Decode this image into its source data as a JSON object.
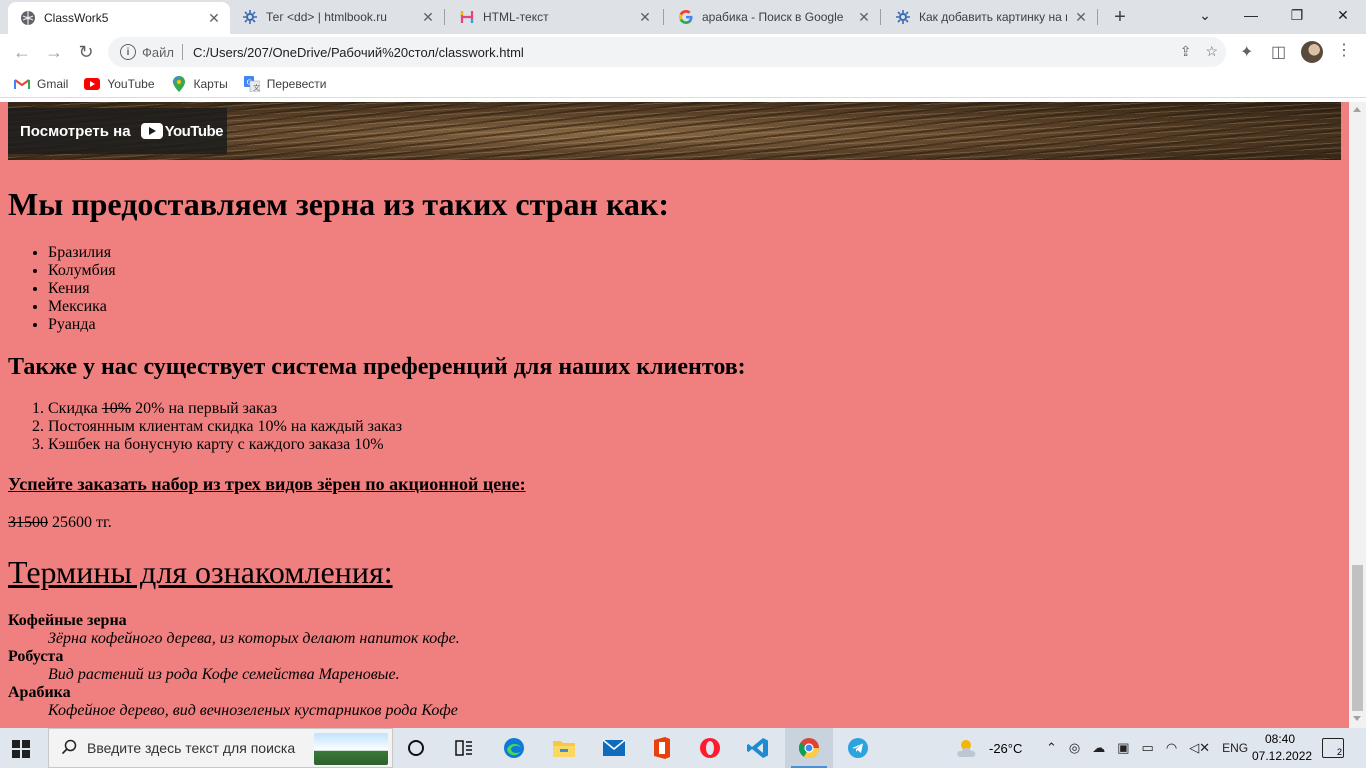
{
  "browser": {
    "tabs": [
      {
        "title": "ClassWork5",
        "icon": "globe-icon",
        "active": true
      },
      {
        "title": "Тег <dd> | htmlbook.ru",
        "icon": "htmlbook-icon",
        "active": false
      },
      {
        "title": "HTML-текст",
        "icon": "html-text-icon",
        "active": false
      },
      {
        "title": "арабика - Поиск в Google",
        "icon": "google-icon",
        "active": false
      },
      {
        "title": "Как добавить картинку на в",
        "icon": "htmlbook-icon",
        "active": false
      }
    ],
    "new_tab_label": "+",
    "address": {
      "scheme_label": "Файл",
      "url": "C:/Users/207/OneDrive/Рабочий%20стол/classwork.html"
    },
    "bookmarks": [
      {
        "label": "Gmail",
        "icon": "gmail-icon"
      },
      {
        "label": "YouTube",
        "icon": "youtube-icon"
      },
      {
        "label": "Карты",
        "icon": "maps-icon"
      },
      {
        "label": "Перевести",
        "icon": "translate-icon"
      }
    ]
  },
  "page": {
    "video": {
      "watch_label": "Посмотреть на",
      "youtube_wordmark": "YouTube"
    },
    "countries_heading": "Мы предоставляем зерна из таких стран как:",
    "countries": [
      "Бразилия",
      "Колумбия",
      "Кения",
      "Мексика",
      "Руанда"
    ],
    "preferences_heading": "Также у нас существует система преференций для наших клиентов:",
    "preferences": {
      "item1_prefix": "Скидка ",
      "item1_old": "10%",
      "item1_rest": " 20% на первый заказ",
      "item2": "Постоянным клиентам скидка 10% на каждый заказ",
      "item3": "Кэшбек на бонусную карту с каждого заказа 10%"
    },
    "promo_heading": "Успейте заказать набор из трех видов зёрен по акционной цене:",
    "price": {
      "old": "31500",
      "new": " 25600 тг."
    },
    "terms_heading": "Термины для ознакомления:",
    "glossary": [
      {
        "term": "Кофейные зерна",
        "definition": "Зёрна кофейного дерева, из которых делают напиток кофе."
      },
      {
        "term": "Робуста",
        "definition": "Вид растений из рода Кофе семейства Мареновые."
      },
      {
        "term": "Арабика",
        "definition": "Кофейное дерево, вид вечнозеленых кустарников рода Кофе"
      }
    ]
  },
  "taskbar": {
    "search_placeholder": "Введите здесь текст для поиска",
    "weather": "-26°C",
    "language": "ENG",
    "time": "08:40",
    "date": "07.12.2022",
    "notifications_count": "2"
  },
  "colors": {
    "page_background": "#f08080",
    "tabstrip": "#dee1e6",
    "taskbar": "#dfe6ee"
  }
}
